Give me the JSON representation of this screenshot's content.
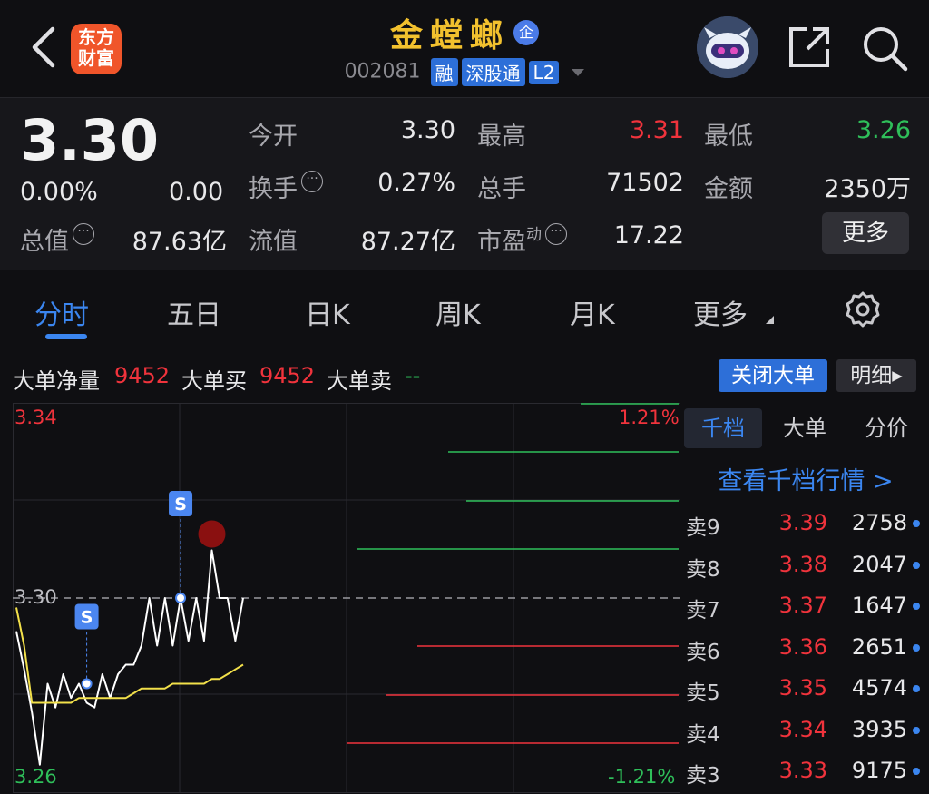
{
  "header": {
    "logo_text_line1": "东方",
    "logo_text_line2": "财富",
    "stock_name": "金螳螂",
    "badge": "企",
    "code": "002081",
    "tags": [
      "融",
      "深股通",
      "L2"
    ],
    "colors": {
      "title": "#f2c12e",
      "accent": "#3b86f0",
      "logo": "#f0552a"
    }
  },
  "quote": {
    "price": "3.30",
    "change_pct": "0.00%",
    "change": "0.00",
    "items": [
      {
        "label": "今开",
        "value": "3.30",
        "tone": "neutral"
      },
      {
        "label": "最高",
        "value": "3.31",
        "tone": "up"
      },
      {
        "label": "最低",
        "value": "3.26",
        "tone": "down"
      },
      {
        "label": "换手",
        "value": "0.27%",
        "tone": "neutral"
      },
      {
        "label": "总手",
        "value": "71502",
        "tone": "neutral"
      },
      {
        "label": "金额",
        "value": "2350万",
        "tone": "neutral"
      },
      {
        "label": "总值",
        "value": "87.63亿",
        "tone": "neutral"
      },
      {
        "label": "流值",
        "value": "87.27亿",
        "tone": "neutral"
      },
      {
        "label": "市盈",
        "sup": "动",
        "value": "17.22",
        "tone": "neutral"
      }
    ],
    "more_button": "更多",
    "info_icon_glyph": "···"
  },
  "tabs": {
    "items": [
      "分时",
      "五日",
      "日K",
      "周K",
      "月K",
      "更多"
    ],
    "active": "分时"
  },
  "big_order": {
    "net_label": "大单净量",
    "net_value": "9452",
    "buy_label": "大单买",
    "buy_value": "9452",
    "sell_label": "大单卖",
    "sell_value": "--",
    "close_button": "关闭大单",
    "detail_button": "明细",
    "detail_arrow": "▸"
  },
  "chart_data": {
    "type": "line",
    "y_left_labels": [
      "3.34",
      "3.30",
      "3.26"
    ],
    "y_right_labels": [
      "1.21%",
      "-1.21%"
    ],
    "ylim": [
      3.26,
      3.34
    ],
    "reference_price": 3.3,
    "marker_label": "S",
    "series": [
      {
        "values": [
          3.293,
          3.285,
          3.276,
          3.265,
          3.282,
          3.277,
          3.284,
          3.279,
          3.282,
          3.278,
          3.277,
          3.284,
          3.279,
          3.284,
          3.286,
          3.286,
          3.29,
          3.3,
          3.29,
          3.3,
          3.29,
          3.3,
          3.291,
          3.3,
          3.291,
          3.31,
          3.3,
          3.3,
          3.291,
          3.3
        ]
      },
      {
        "values": [
          3.298,
          3.29,
          3.278,
          3.278,
          3.278,
          3.278,
          3.278,
          3.278,
          3.279,
          3.279,
          3.279,
          3.279,
          3.279,
          3.279,
          3.279,
          3.28,
          3.281,
          3.281,
          3.281,
          3.281,
          3.282,
          3.282,
          3.282,
          3.282,
          3.282,
          3.283,
          3.283,
          3.284,
          3.285,
          3.286
        ]
      }
    ]
  },
  "order_book": {
    "tabs": [
      "千档",
      "大单",
      "分价"
    ],
    "active_tab": "千档",
    "link": "查看千档行情 >",
    "asks": [
      {
        "level": "卖9",
        "price": "3.39",
        "volume": "2758"
      },
      {
        "level": "卖8",
        "price": "3.38",
        "volume": "2047"
      },
      {
        "level": "卖7",
        "price": "3.37",
        "volume": "1647"
      },
      {
        "level": "卖6",
        "price": "3.36",
        "volume": "2651"
      },
      {
        "level": "卖5",
        "price": "3.35",
        "volume": "4574"
      },
      {
        "level": "卖4",
        "price": "3.34",
        "volume": "3935"
      },
      {
        "level": "卖3",
        "price": "3.33",
        "volume": "9175"
      }
    ],
    "depth_levels_green": 4,
    "depth_levels_red": 3
  }
}
